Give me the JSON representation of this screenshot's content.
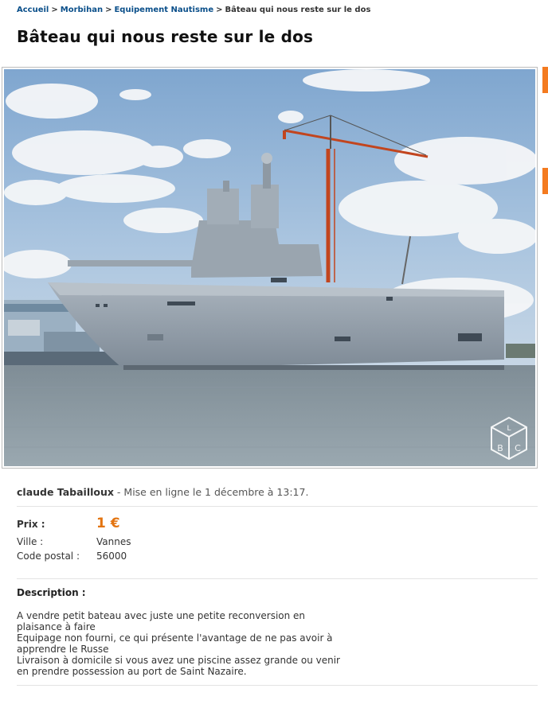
{
  "breadcrumb": {
    "items": [
      "Accueil",
      "Morbihan",
      "Equipement Nautisme"
    ],
    "separator": ">",
    "current": "Bâteau qui nous reste sur le dos"
  },
  "title": "Bâteau qui nous reste sur le dos",
  "photo": {
    "alt": "Bâteau qui nous reste sur le dos",
    "watermark_icon": "leboncoin-cube-logo-icon",
    "watermark_letters": [
      "L",
      "B",
      "C"
    ]
  },
  "seller": {
    "name": "claude Tabailloux",
    "posted": " - Mise en ligne le 1 décembre à 13:17."
  },
  "details": {
    "price_label": "Prix :",
    "price_value": "1 €",
    "city_label": "Ville :",
    "city_value": "Vannes",
    "postcode_label": "Code postal :",
    "postcode_value": "56000"
  },
  "description": {
    "title": "Description :",
    "text": "A vendre petit bateau avec juste une petite reconversion en\nplaisance à faire\nEquipage non fourni, ce qui présente l'avantage de ne pas avoir à\napprendre le Russe\nLivraison à domicile si vous avez une piscine assez grande ou venir\nen prendre possession au port de Saint Nazaire."
  },
  "colors": {
    "accent": "#f47b20",
    "price": "#e37410",
    "link": "#0a4f8a"
  }
}
